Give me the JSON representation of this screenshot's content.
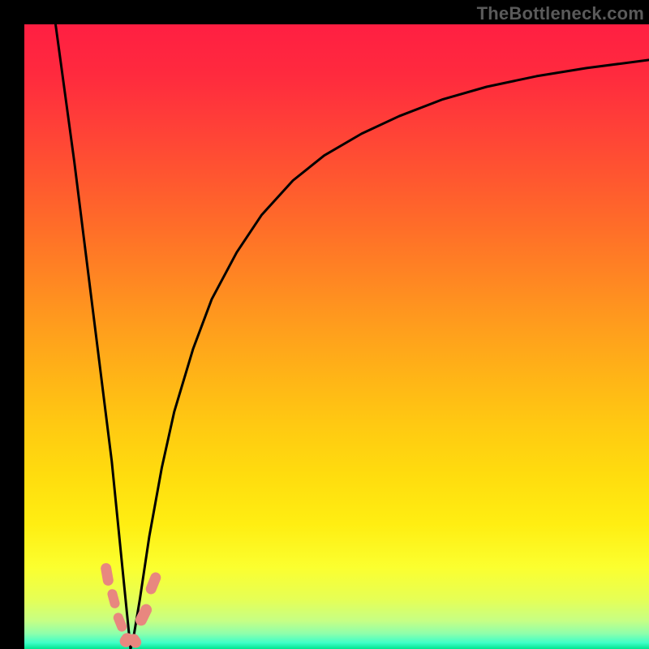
{
  "watermark": "TheBottleneck.com",
  "colors": {
    "bg_black": "#000000",
    "curve_stroke": "#000000",
    "marker_fill": "#e8877f",
    "gradient_stops": [
      {
        "t": 0.0,
        "hex": "#ff1f42"
      },
      {
        "t": 0.08,
        "hex": "#ff2a3e"
      },
      {
        "t": 0.16,
        "hex": "#ff3f38"
      },
      {
        "t": 0.24,
        "hex": "#ff5530"
      },
      {
        "t": 0.32,
        "hex": "#ff6c29"
      },
      {
        "t": 0.4,
        "hex": "#ff8423"
      },
      {
        "t": 0.48,
        "hex": "#ff9c1d"
      },
      {
        "t": 0.56,
        "hex": "#ffb317"
      },
      {
        "t": 0.64,
        "hex": "#ffc912"
      },
      {
        "t": 0.72,
        "hex": "#ffdc0e"
      },
      {
        "t": 0.8,
        "hex": "#ffee12"
      },
      {
        "t": 0.87,
        "hex": "#fbff2f"
      },
      {
        "t": 0.92,
        "hex": "#e6ff55"
      },
      {
        "t": 0.955,
        "hex": "#c6ff85"
      },
      {
        "t": 0.975,
        "hex": "#8fffab"
      },
      {
        "t": 0.99,
        "hex": "#3fffc8"
      },
      {
        "t": 1.0,
        "hex": "#00e690"
      }
    ]
  },
  "chart_data": {
    "type": "line",
    "title": "",
    "xlabel": "",
    "ylabel": "",
    "xlim": [
      0,
      100
    ],
    "ylim": [
      0,
      100
    ],
    "x_minimum": 17,
    "curve": {
      "description": "Bottleneck severity curve. y=0 at x≈17, rises steeply on both sides; left branch reaches y=100 at x≈5; right branch asymptotically approaches y≈94 at x=100.",
      "points": [
        {
          "x": 5.0,
          "y": 100.0
        },
        {
          "x": 6.5,
          "y": 89.0
        },
        {
          "x": 8.0,
          "y": 78.0
        },
        {
          "x": 9.5,
          "y": 66.0
        },
        {
          "x": 11.0,
          "y": 54.0
        },
        {
          "x": 12.5,
          "y": 42.0
        },
        {
          "x": 14.0,
          "y": 30.0
        },
        {
          "x": 15.0,
          "y": 20.0
        },
        {
          "x": 16.0,
          "y": 10.0
        },
        {
          "x": 16.7,
          "y": 3.0
        },
        {
          "x": 17.0,
          "y": 0.0
        },
        {
          "x": 17.5,
          "y": 2.0
        },
        {
          "x": 18.5,
          "y": 8.0
        },
        {
          "x": 20.0,
          "y": 18.0
        },
        {
          "x": 22.0,
          "y": 29.0
        },
        {
          "x": 24.0,
          "y": 38.0
        },
        {
          "x": 27.0,
          "y": 48.0
        },
        {
          "x": 30.0,
          "y": 56.0
        },
        {
          "x": 34.0,
          "y": 63.5
        },
        {
          "x": 38.0,
          "y": 69.5
        },
        {
          "x": 43.0,
          "y": 75.0
        },
        {
          "x": 48.0,
          "y": 79.0
        },
        {
          "x": 54.0,
          "y": 82.5
        },
        {
          "x": 60.0,
          "y": 85.3
        },
        {
          "x": 67.0,
          "y": 88.0
        },
        {
          "x": 74.0,
          "y": 90.0
        },
        {
          "x": 82.0,
          "y": 91.7
        },
        {
          "x": 90.0,
          "y": 93.0
        },
        {
          "x": 100.0,
          "y": 94.3
        }
      ]
    },
    "good_zone_y_threshold": 14,
    "markers": [
      {
        "x": 13.3,
        "y": 12.0,
        "w": 13,
        "h": 28,
        "rot": -10
      },
      {
        "x": 14.3,
        "y": 8.0,
        "w": 12,
        "h": 24,
        "rot": -15
      },
      {
        "x": 15.3,
        "y": 4.3,
        "w": 12,
        "h": 24,
        "rot": -22
      },
      {
        "x": 16.3,
        "y": 1.4,
        "w": 18,
        "h": 15,
        "rot": -55
      },
      {
        "x": 17.6,
        "y": 1.3,
        "w": 18,
        "h": 14,
        "rot": 55
      },
      {
        "x": 19.1,
        "y": 5.5,
        "w": 14,
        "h": 28,
        "rot": 26
      },
      {
        "x": 20.6,
        "y": 10.5,
        "w": 13,
        "h": 28,
        "rot": 22
      }
    ]
  }
}
